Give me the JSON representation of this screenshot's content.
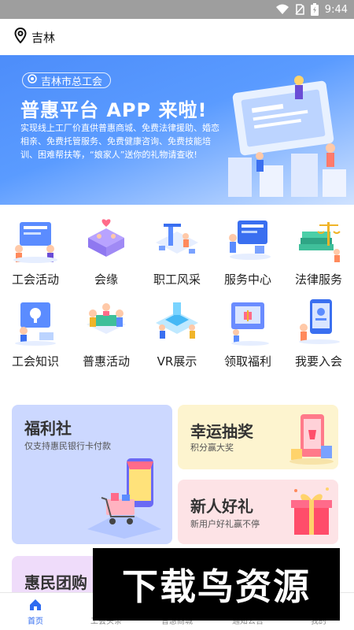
{
  "status": {
    "time": "9:44"
  },
  "location": {
    "city": "吉林"
  },
  "banner": {
    "org": "吉林市总工会",
    "headline": "普惠平台 APP 来啦!",
    "desc": "实现线上工厂价直供普惠商城、免费法律援助、婚恋相亲、免费托管服务、免费健康咨询、免费技能培训、困难帮扶等，“娘家人”送你的礼物请查收!"
  },
  "grid": [
    {
      "label": "工会活动",
      "icon": "union-activity-icon"
    },
    {
      "label": "会缘",
      "icon": "matchmaking-icon"
    },
    {
      "label": "职工风采",
      "icon": "worker-showcase-icon"
    },
    {
      "label": "服务中心",
      "icon": "service-center-icon"
    },
    {
      "label": "法律服务",
      "icon": "legal-service-icon"
    },
    {
      "label": "工会知识",
      "icon": "union-knowledge-icon"
    },
    {
      "label": "普惠活动",
      "icon": "benefit-activity-icon"
    },
    {
      "label": "VR展示",
      "icon": "vr-display-icon"
    },
    {
      "label": "领取福利",
      "icon": "claim-benefits-icon"
    },
    {
      "label": "我要入会",
      "icon": "join-union-icon"
    }
  ],
  "cards": {
    "fuli": {
      "title": "福利社",
      "subtitle": "仅支持惠民银行卡付款"
    },
    "xingyun": {
      "title": "幸运抽奖",
      "subtitle": "积分赢大奖"
    },
    "xinren": {
      "title": "新人好礼",
      "subtitle": "新用户好礼赢不停"
    },
    "tuangou": {
      "title": "惠民团购"
    }
  },
  "tabs": [
    {
      "label": "首页",
      "icon": "home-icon",
      "active": true
    },
    {
      "label": "工会头条",
      "icon": "news-icon",
      "active": false
    },
    {
      "label": "普惠商城",
      "icon": "mall-icon",
      "active": false
    },
    {
      "label": "通知公告",
      "icon": "notice-icon",
      "active": false
    },
    {
      "label": "我的",
      "icon": "profile-icon",
      "active": false
    }
  ],
  "watermark": "下载鸟资源",
  "colors": {
    "accent": "#2f6bf0",
    "banner": "#5a9bff"
  }
}
